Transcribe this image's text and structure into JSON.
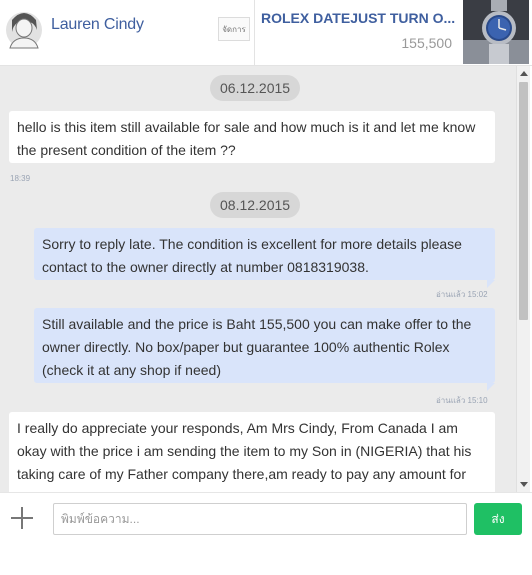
{
  "header": {
    "contact_name": "Lauren Cindy",
    "manage_label": "จัดการ",
    "product_title": "ROLEX DATEJUST TURN O...",
    "product_price": "155,500"
  },
  "messages": [
    {
      "type": "date",
      "text": "06.12.2015"
    },
    {
      "type": "incoming",
      "text": "hello is this item still available for sale and how much is it and let me know the present condition of the item ??",
      "time": "18:39"
    },
    {
      "type": "date",
      "text": "08.12.2015"
    },
    {
      "type": "outgoing",
      "text": "Sorry to reply late. The condition is excellent for more details please contact to the owner directly at number 0818319038.",
      "status": "อ่านแล้ว 15:02"
    },
    {
      "type": "outgoing",
      "text": "Still available and the price is Baht 155,500 you can make offer to the owner directly. No box/paper but guarantee 100% authentic Rolex (check it at any shop if need)",
      "status": "อ่านแล้ว 15:10"
    },
    {
      "type": "incoming",
      "text": "I really do appreciate your responds, Am Mrs Cindy, From Canada I am okay with the price i am sending the item to my Son in (NIGERIA) that his taking care of my Father company there,am ready to pay any amount for this item"
    }
  ],
  "composer": {
    "placeholder": "พิมพ์ข้อความ...",
    "send_label": "ส่ง"
  },
  "colors": {
    "accent_name": "#3f5f9f",
    "outgoing_bubble": "#d9e4fa",
    "chat_background": "#ebebeb",
    "send_button": "#1fc064"
  }
}
